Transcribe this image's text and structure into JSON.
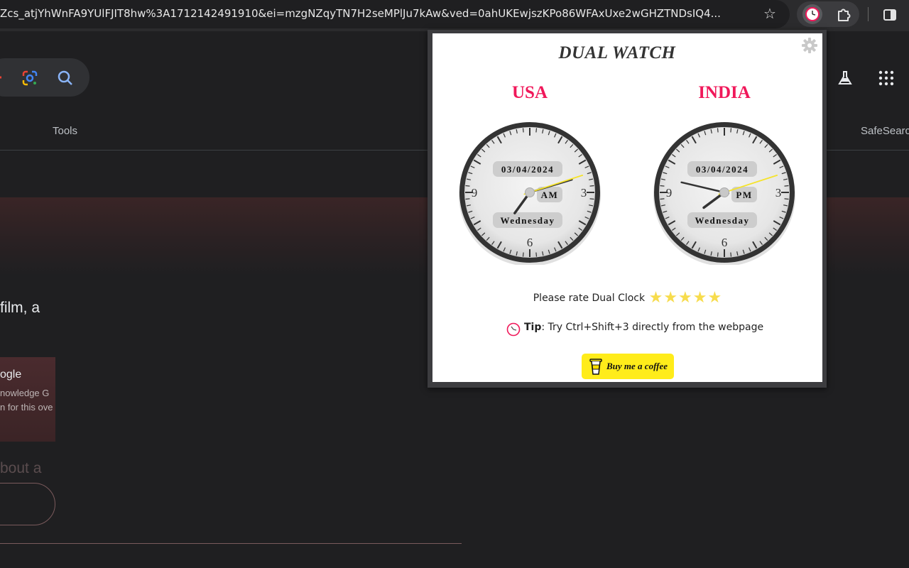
{
  "browser": {
    "url": "Zcs_atjYhWnFA9YUlFJIT8hw%3A1712142491910&ei=mzgNZqyTN7H2seMPlJu7kAw&ved=0ahUKEwjszKPo86WFAxUxe2wGHZTNDsIQ4..."
  },
  "google_page": {
    "tools_label": "Tools",
    "safesearch_label": "SafeSearch",
    "snippet_text": "film, a",
    "card_title": "ogle",
    "card_line1": "nowledge G",
    "card_line2": "n for this ove",
    "faded_text": "bout a"
  },
  "popup": {
    "title": "DUAL WATCH",
    "clocks": [
      {
        "country": "USA",
        "date": "03/04/2024",
        "ampm": "AM",
        "day": "Wednesday",
        "hour": 7,
        "minute": 12,
        "second": 12
      },
      {
        "country": "INDIA",
        "date": "03/04/2024",
        "ampm": "PM",
        "day": "Wednesday",
        "hour": 7,
        "minute": 47,
        "second": 12
      }
    ],
    "rate_text": "Please rate Dual Clock",
    "rating": {
      "stars": 5
    },
    "tip_label": "Tip",
    "tip_text": ": Try Ctrl+Shift+3 directly from the webpage",
    "coffee_label": "Buy me a coffee"
  },
  "colors": {
    "country": "#f0185a",
    "star": "#f7dc4d",
    "second_hand": "#f5e32b",
    "coffee_button": "#ffec1a"
  }
}
